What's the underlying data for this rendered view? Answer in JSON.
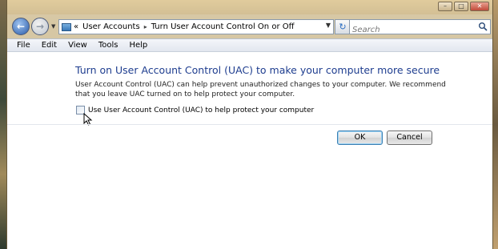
{
  "window": {
    "controls": {
      "minimize": "–",
      "maximize": "□",
      "close": "✕"
    }
  },
  "nav": {
    "back_icon": "arrow-left-icon",
    "forward_icon": "arrow-right-icon",
    "address": {
      "prefix": "«",
      "segments": [
        "User Accounts",
        "Turn User Account Control On or Off"
      ],
      "separator": "▸"
    },
    "refresh_glyph": "↻",
    "search": {
      "placeholder": "Search"
    }
  },
  "menu": [
    "File",
    "Edit",
    "View",
    "Tools",
    "Help"
  ],
  "content": {
    "title": "Turn on User Account Control (UAC) to make your computer more secure",
    "description": "User Account Control (UAC) can help prevent unauthorized changes to your computer.  We recommend that you leave UAC turned on to help protect your computer.",
    "checkbox_label": "Use User Account Control (UAC) to help protect your computer",
    "checkbox_checked": false
  },
  "buttons": {
    "ok": "OK",
    "cancel": "Cancel"
  },
  "colors": {
    "title": "#1e3d8f",
    "accent": "#2a5ba8"
  }
}
